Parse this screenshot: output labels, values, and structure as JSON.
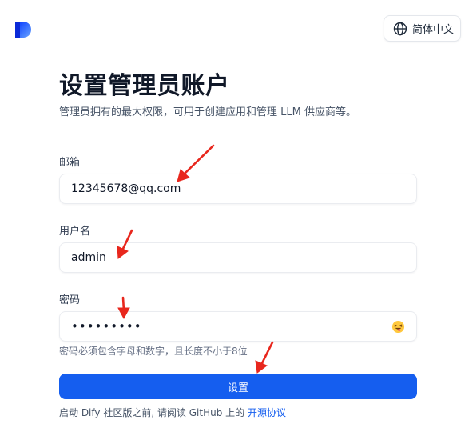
{
  "header": {
    "language_label": "简体中文",
    "language_icon": "globe-icon",
    "logo_icon": "dify-logo"
  },
  "main": {
    "title": "设置管理员账户",
    "subtitle": "管理员拥有的最大权限，可用于创建应用和管理 LLM 供应商等。",
    "email": {
      "label": "邮箱",
      "value": "12345678@qq.com"
    },
    "username": {
      "label": "用户名",
      "value": "admin"
    },
    "password": {
      "label": "密码",
      "value": "•••••••••",
      "hint": "密码必须包含字母和数字，且长度不小于8位",
      "toggle_icon": "emoji-icon"
    },
    "submit_label": "设置",
    "footer": {
      "text": "启动 Dify 社区版之前, 请阅读 GitHub 上的 ",
      "link": "开源协议"
    }
  },
  "colors": {
    "primary": "#155eef",
    "annotation": "#e8271d"
  }
}
